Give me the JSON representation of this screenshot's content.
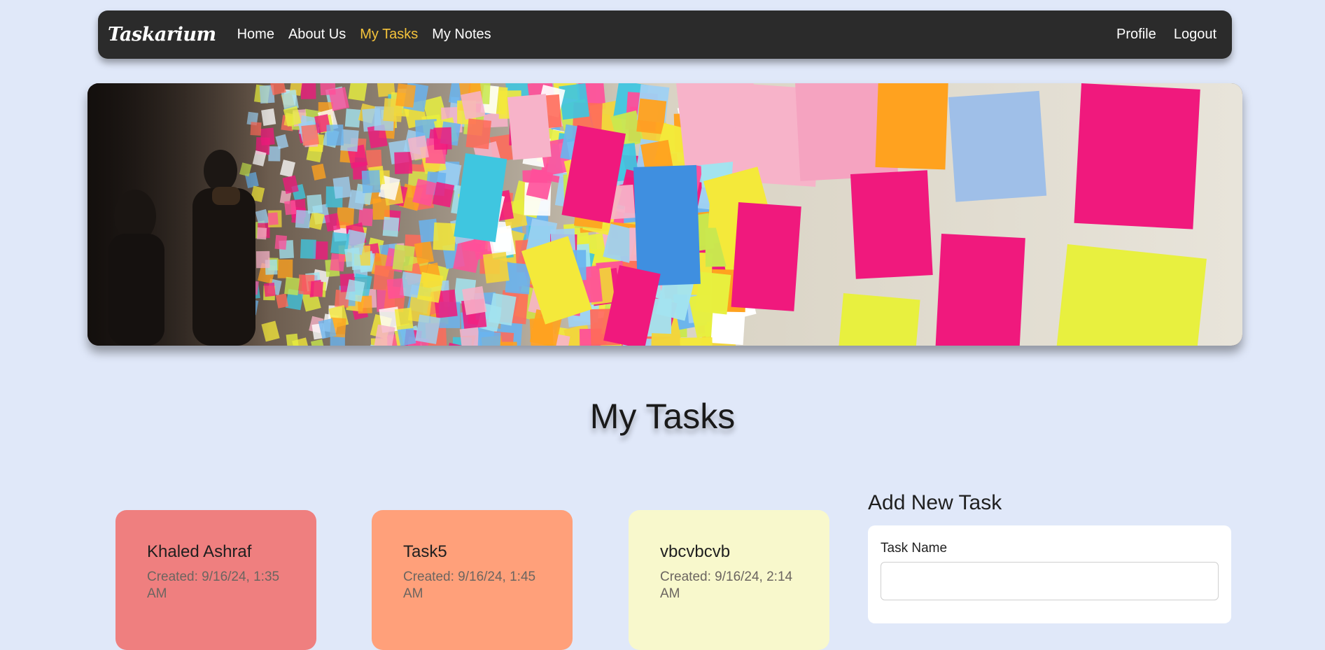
{
  "nav": {
    "brand": "Taskarium",
    "links": [
      "Home",
      "About Us",
      "My Tasks",
      "My Notes"
    ],
    "active": "My Tasks",
    "right_links": [
      "Profile",
      "Logout"
    ],
    "active_color": "#f5c33b"
  },
  "hero": {
    "image": "sticky-notes-wall-photo"
  },
  "page_title": "My Tasks",
  "tasks": [
    {
      "name": "Khaled Ashraf",
      "created": "Created: 9/16/24, 1:35 AM",
      "color": "#ef7f7f"
    },
    {
      "name": "Task5",
      "created": "Created: 9/16/24, 1:45 AM",
      "color": "#ffa07a"
    },
    {
      "name": "vbcvbcvb",
      "created": "Created: 9/16/24, 2:14 AM",
      "color": "#f8f8cc"
    }
  ],
  "add_task": {
    "heading": "Add New Task",
    "task_name_label": "Task Name",
    "task_name_value": ""
  }
}
